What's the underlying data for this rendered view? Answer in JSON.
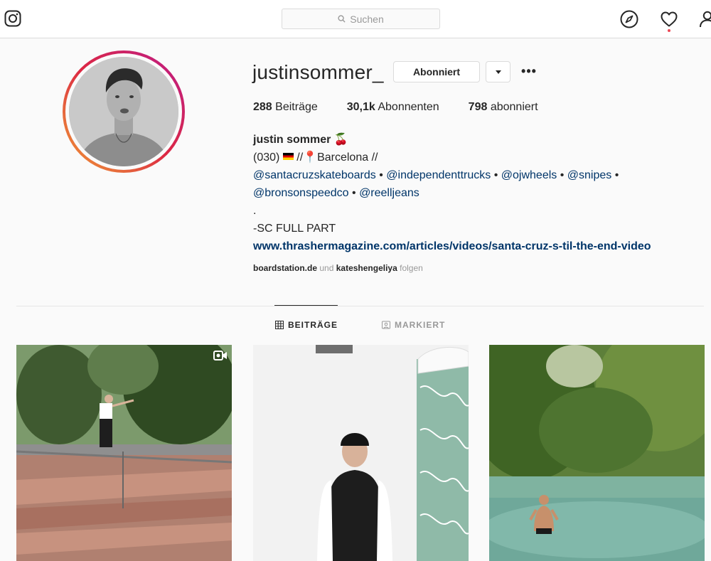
{
  "topbar": {
    "logo_icon": "instagram-icon",
    "search": {
      "placeholder": "Suchen",
      "icon": "search-icon"
    },
    "nav_icons": [
      "compass-icon",
      "heart-icon",
      "user-icon"
    ],
    "notification_color": "#ed4956"
  },
  "profile": {
    "username": "justinsommer_",
    "follow_button": "Abonniert",
    "more_options": "•••",
    "stats": [
      {
        "count": "288",
        "label": "Beiträge"
      },
      {
        "count": "30,1k",
        "label": "Abonnenten"
      },
      {
        "count": "798",
        "label": "abonniert"
      }
    ],
    "bio": {
      "name": "justin sommer 🍒",
      "line1_prefix": "(030)",
      "line1_sep": "//",
      "line1_place": "Barcelona //",
      "mentions_row1": [
        "@santacruzskateboards",
        "@independenttrucks",
        "@ojwheels",
        "@snipes"
      ],
      "mentions_row2": [
        "@bronsonspeedco",
        "@reelljeans"
      ],
      "dot": ".",
      "part_line": "-SC FULL PART",
      "link": "www.thrashermagazine.com/articles/videos/santa-cruz-s-til-the-end-video"
    },
    "followed_by": {
      "user1": "boardstation.de",
      "joiner": "und",
      "user2": "kateshengeliya",
      "suffix": "folgen"
    }
  },
  "tabs": [
    {
      "label": "BEITRÄGE",
      "icon": "grid-icon",
      "active": true
    },
    {
      "label": "MARKIERT",
      "icon": "tag-icon",
      "active": false
    }
  ],
  "posts": [
    {
      "type": "video",
      "icon": "video-icon"
    },
    {
      "type": "image"
    },
    {
      "type": "image"
    }
  ],
  "colors": {
    "accent_link": "#003569",
    "border": "#dbdbdb",
    "background": "#fafafa",
    "muted_text": "#999999"
  }
}
